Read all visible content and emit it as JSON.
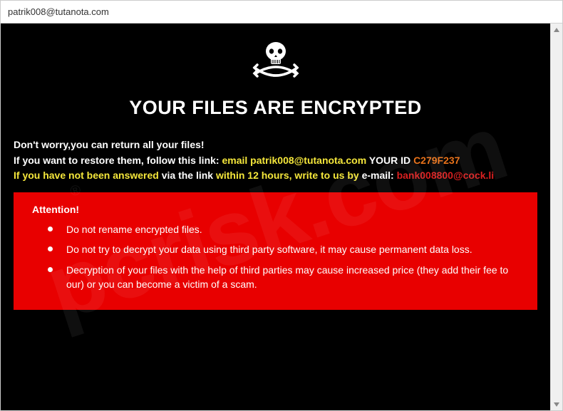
{
  "window": {
    "title": "patrik008@tutanota.com"
  },
  "heading": "YOUR FILES ARE ENCRYPTED",
  "intro": {
    "line1": "Don't worry,you can return all your files!",
    "line2_a": "If you want to restore them, follow this link: ",
    "line2_email_label": "email patrik008@tutanota.com",
    "line2_yourid": "  YOUR ID ",
    "line2_id": "C279F237",
    "line3_a": "If you have not been answered ",
    "line3_b": "via the link ",
    "line3_c": "within 12 hours, write to us by ",
    "line3_d": "e-mail: ",
    "line3_email": "bank008800@cock.li"
  },
  "attention": {
    "title": "Attention!",
    "items": [
      "Do not rename encrypted files.",
      "Do not try to decrypt your data using third party software, it may cause permanent data loss.",
      "Decryption of your files with the help of third parties may cause increased price (they add their fee to our) or you can become a victim of a scam."
    ]
  },
  "watermark": "pcrisk.com"
}
